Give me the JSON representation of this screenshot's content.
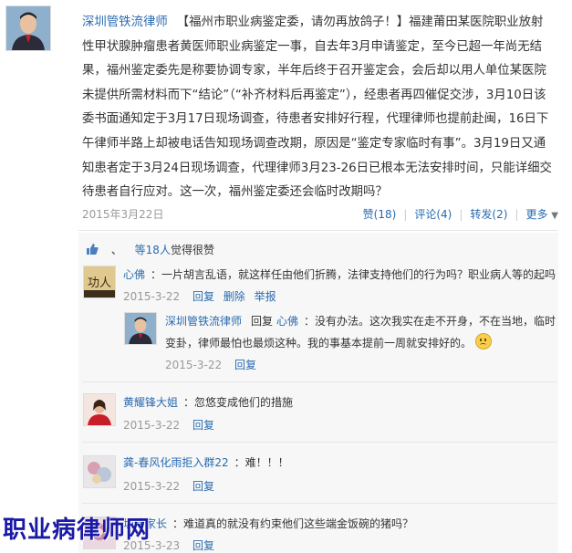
{
  "post": {
    "author": "深圳管铁流律师",
    "text": "【福州市职业病鉴定委，请勿再放鸽子！】福建莆田某医院职业放射性甲状腺肿瘤患者黄医师职业病鉴定一事，自去年3月申请鉴定，至今已超一年尚无结果，福州鉴定委先是称要协调专家，半年后终于召开鉴定会，会后却以用人单位某医院未提供所需材料而下“结论”（“补齐材料后再鉴定”），经患者再四催促交涉，3月10日该委书面通知定于3月17日现场调查，待患者安排好行程，代理律师也提前赴闽，16日下午律师半路上却被电话告知现场调查改期，原因是“鉴定专家临时有事”。3月19日又通知患者定于3月24日现场调查，代理律师3月23-26日已根本无法安排时间，只能详细交待患者自行应对。这一次，福州鉴定委还会临时改期吗？",
    "date": "2015年3月22日",
    "actions": {
      "like": "赞(18)",
      "comment": "评论(4)",
      "repost": "转发(2)",
      "more": "更多"
    }
  },
  "likes_line": {
    "prefix": "、",
    "count_text": "等18人",
    "suffix": "觉得很赞"
  },
  "comments": [
    {
      "author": "心佛",
      "text": "：一片胡言乱语，就这样任由他们折腾，法律支持他们的行为吗？职业病人等的起吗",
      "date": "2015-3-22",
      "links": [
        "回复",
        "删除",
        "举报"
      ],
      "reply": {
        "author": "深圳管铁流律师",
        "reply_word": "回复",
        "to": "心佛",
        "line1": "：没有办法。这次我实在走不开身，不在当地，临时",
        "line2": "变卦，律师最怕也最烦这种。我的事基本提前一周就安排好的。",
        "date": "2015-3-22",
        "link": "回复"
      }
    },
    {
      "author": "黄耀锋大姐",
      "text": "：忽悠变成他们的措施",
      "date": "2015-3-22",
      "link": "回复"
    },
    {
      "author": "龚-春风化雨拒入群22",
      "text": "：难！！！",
      "date": "2015-3-22",
      "link": "回复"
    },
    {
      "author": "圳伟家长",
      "text": "：难道真的就没有约束他们这些端金饭碗的猪吗？",
      "date": "2015-3-23",
      "link": "回复"
    }
  ],
  "watermark": "职业病律师网",
  "colors": {
    "link": "#2a6bb0",
    "meta": "#999999",
    "text": "#333333"
  }
}
